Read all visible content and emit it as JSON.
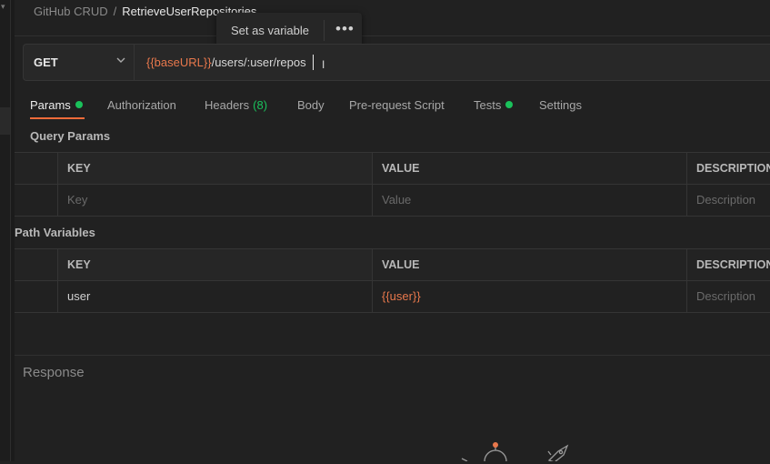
{
  "breadcrumb": {
    "collection": "GitHub CRUD",
    "separator": "/",
    "request": "RetrieveUserRepositories"
  },
  "popup": {
    "label": "Set as variable",
    "more": "•••"
  },
  "request": {
    "method": "GET",
    "url_var": "{{baseURL}}",
    "url_path": "/users/:user/repos"
  },
  "tabs": [
    {
      "label": "Params",
      "dot": true,
      "active": true
    },
    {
      "label": "Authorization"
    },
    {
      "label": "Headers",
      "count": "(8)"
    },
    {
      "label": "Body"
    },
    {
      "label": "Pre-request Script"
    },
    {
      "label": "Tests",
      "dot": true
    },
    {
      "label": "Settings"
    }
  ],
  "query_params": {
    "title": "Query Params",
    "columns": [
      "KEY",
      "VALUE",
      "DESCRIPTION"
    ],
    "placeholders": [
      "Key",
      "Value",
      "Description"
    ]
  },
  "path_variables": {
    "title": "Path Variables",
    "columns": [
      "KEY",
      "VALUE",
      "DESCRIPTION"
    ],
    "rows": [
      {
        "key": "user",
        "value": "{{user}}",
        "description_placeholder": "Description"
      }
    ]
  },
  "response": {
    "title": "Response"
  },
  "colors": {
    "accent": "#f26b3a",
    "variable": "#e8784c",
    "dot": "#1ac15b"
  }
}
